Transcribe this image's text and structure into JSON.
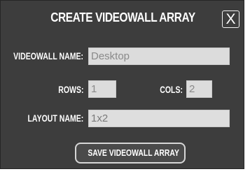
{
  "dialog": {
    "title": "CREATE VIDEOWALL ARRAY",
    "close_label": "X",
    "fields": {
      "videowall_name": {
        "label": "VIDEOWALL NAME:",
        "value": "Desktop"
      },
      "rows": {
        "label": "ROWS:",
        "value": "1"
      },
      "cols": {
        "label": "COLS:",
        "value": "2"
      },
      "layout_name": {
        "label": "LAYOUT NAME:",
        "value": "1x2"
      }
    },
    "save_label": "SAVE VIDEOWALL ARRAY"
  },
  "colors": {
    "dialog_background": "#3d3d3d",
    "field_background": "#dcdcdc",
    "field_text": "#8a8a8a",
    "label_text": "#ffffff"
  }
}
